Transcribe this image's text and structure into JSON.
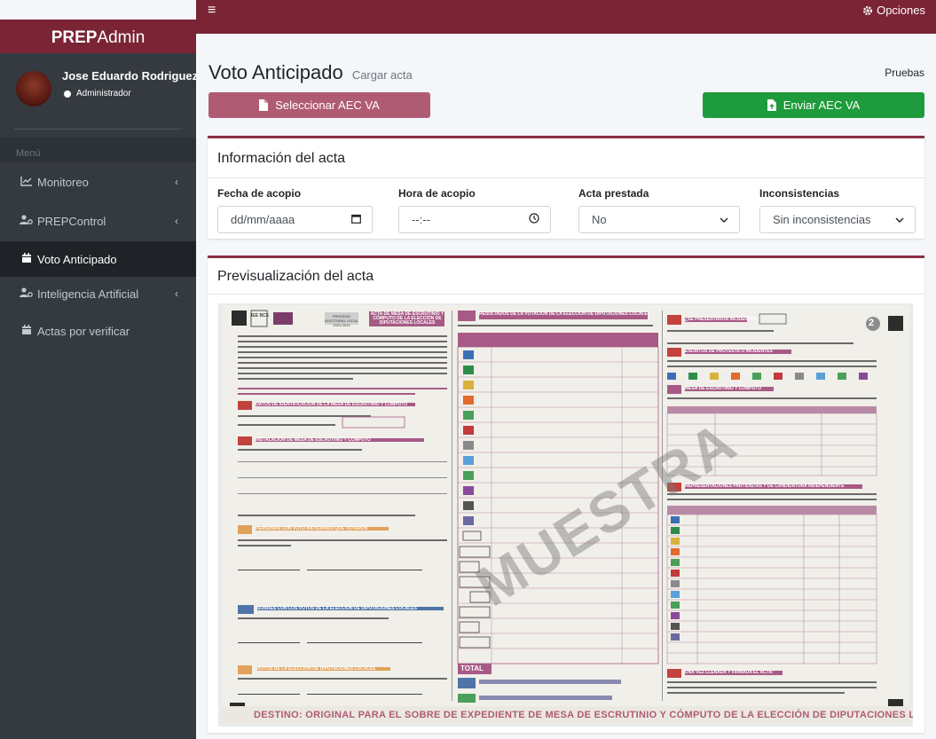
{
  "brand": {
    "bold": "PREP",
    "light": "Admin"
  },
  "header": {
    "menu_icon": "hamburger-icon",
    "options_label": "Opciones"
  },
  "user": {
    "name": "Jose Eduardo Rodriguez",
    "role": "Administrador"
  },
  "sidebar": {
    "menu_header": "Menú",
    "items": [
      {
        "label": "Monitoreo",
        "icon": "line-chart-icon"
      },
      {
        "label": "PREPControl",
        "icon": "users-cog-icon"
      },
      {
        "label": "Voto Anticipado",
        "icon": "calendar-icon"
      },
      {
        "label": "Inteligencia Artificial",
        "icon": "users-cog-icon"
      },
      {
        "label": "Actas por verificar",
        "icon": "calendar-icon"
      }
    ]
  },
  "page": {
    "title": "Voto Anticipado",
    "subtitle": "Cargar acta",
    "breadcrumb": "Pruebas"
  },
  "actions": {
    "select_label": "Seleccionar AEC VA",
    "send_label": "Enviar AEC VA"
  },
  "info_card": {
    "title": "Información del acta",
    "fields": [
      {
        "label": "Fecha de acopio",
        "value": "dd/mm/aaaa"
      },
      {
        "label": "Hora de acopio",
        "value": "--:--"
      },
      {
        "label": "Acta prestada",
        "value": "No"
      },
      {
        "label": "Inconsistencias",
        "value": "Sin inconsistencias"
      }
    ]
  },
  "preview_card": {
    "title": "Previsualización del acta",
    "document": {
      "header_center": "ACTA DE MESA DE ESCRUTINIO Y CÓMPUTO DE LA ELECCIÓN DE DIPUTACIONES LOCALES",
      "header_logo": "IEE BCS",
      "header_middle": "PROCESO ELECTORAL LOCAL 2023-2024",
      "col1_s1": "DATOS DE IDENTIFICACIÓN DE LA MESA DE ESCRUTINIO Y CÓMPUTO",
      "col1_s2": "INSTALACIÓN DE MESA DE ESCRUTINIO Y CÓMPUTO",
      "col1_s3": "PERSONAS CON VOTO ANTICIPADO QUE VOTARON",
      "col1_s4": "SOBRES CON LOS VOTOS DE LA ELECCIÓN DE DIPUTACIONES LOCALES",
      "col1_s5": "VOTOS DE LA ELECCIÓN DE DIPUTACIONES LOCALES",
      "col2_title": "RESULTADOS DE LA VOTACIÓN DE LA ELECCIÓN DE DIPUTACIONES LOCALES",
      "col2_total": "TOTAL",
      "col3_s1": "¿SE PRESENTARON INCIDENTES?",
      "col3_s2": "ESCRITOS DE PROTESTA O INCIDENTES",
      "col3_s3": "MESA DE ESCRUTINIO Y CÓMPUTO",
      "col3_s4": "REPRESENTACIONES PARTIDISTAS Y DE CANDIDATURA INDEPENDIENTE",
      "col3_s5": "UNA VEZ LLENADA Y FIRMADA EL ACTA:",
      "page_number": "2",
      "watermark": "MUESTRA",
      "footer": "DESTINO: ORIGINAL PARA EL SOBRE DE EXPEDIENTE DE MESA DE ESCRUTINIO Y CÓMPUTO DE LA ELECCIÓN DE DIPUTACIONES LOCALES"
    }
  }
}
